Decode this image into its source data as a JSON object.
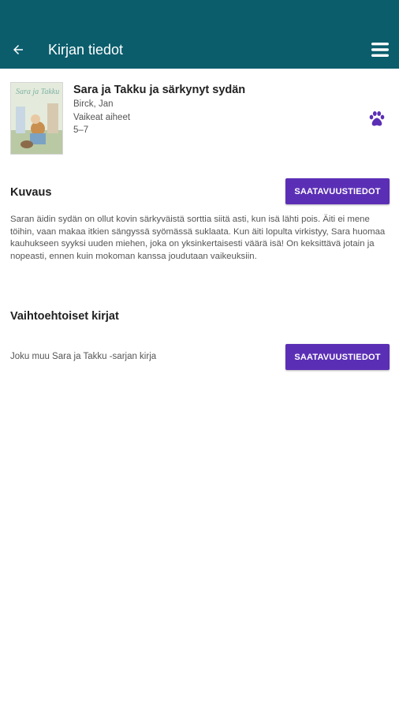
{
  "appbar": {
    "title": "Kirjan tiedot",
    "back_icon": "arrow-left-icon",
    "menu_icon": "hamburger-menu-icon",
    "background_color": "#0b5d6c"
  },
  "book": {
    "title": "Sara ja Takku ja särkynyt sydän",
    "author": "Birck, Jan",
    "category": "Vaikeat aiheet",
    "age_range": "5–7",
    "cover_alt": "Sara ja Takku book cover",
    "cover_text": "Sara ja Takku",
    "type_icon": "paw-icon",
    "accent_color": "#5b2fb5"
  },
  "description_section": {
    "heading": "Kuvaus",
    "button_label": "SAATAVUUSTIEDOT",
    "text": "Saran äidin sydän on ollut kovin särkyväistä sorttia siitä asti, kun isä lähti pois. Äiti ei mene töihin, vaan makaa itkien sängyssä syömässä suklaata. Kun äiti lopulta virkistyy, Sara huomaa kauhukseen syyksi uuden miehen, joka on yksinkertaisesti väärä isä! On keksittävä jotain ja nopeasti, ennen kuin mokoman kanssa joudutaan vaikeuksiin."
  },
  "alternatives_section": {
    "heading": "Vaihtoehtoiset kirjat",
    "item_text": "Joku muu Sara ja Takku -sarjan kirja",
    "button_label": "SAATAVUUSTIEDOT"
  }
}
